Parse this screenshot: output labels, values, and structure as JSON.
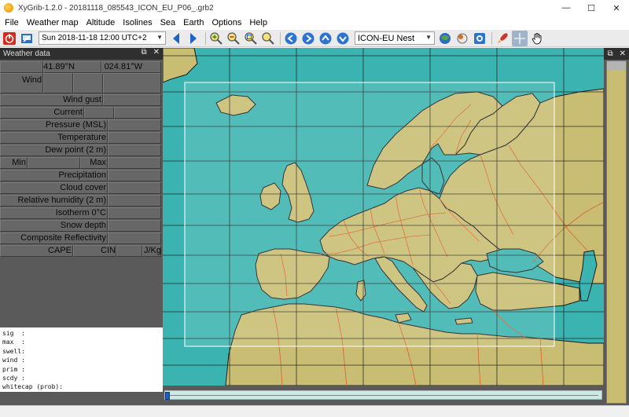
{
  "window": {
    "title": "XyGrib-1.2.0 - 20181118_085543_ICON_EU_P06_.grb2",
    "minimize": "—",
    "maximize": "☐",
    "close": "✕"
  },
  "menu": [
    "File",
    "Weather map",
    "Altitude",
    "Isolines",
    "Sea",
    "Earth",
    "Options",
    "Help"
  ],
  "toolbar": {
    "date_value": "Sun 2018-11-18 12:00 UTC+2",
    "model_value": "ICON-EU Nest"
  },
  "weather_panel": {
    "title": "Weather data",
    "latitude": "41.89°N",
    "longitude": "024.81°W",
    "labels": {
      "wind": "Wind",
      "wind_gust": "Wind gust",
      "current": "Current",
      "pressure": "Pressure (MSL)",
      "temperature": "Temperature",
      "dew_point": "Dew point (2 m)",
      "min": "Min",
      "max": "Max",
      "precipitation": "Precipitation",
      "cloud_cover": "Cloud cover",
      "relative_humidity": "Relative humidity (2 m)",
      "isotherm": "Isotherm 0°C",
      "snow_depth": "Snow depth",
      "composite_reflectivity": "Composite Reflectivity",
      "cape": "CAPE",
      "cin": "CIN",
      "jkg": "J/Kg"
    },
    "wave_text": "sig  :\nmax  :\nswell:\nwind :\nprim :\nscdy :\nwhitecap (prob):"
  },
  "colors": {
    "sea": "#3bb3b0",
    "land": "#c8bd72",
    "border": "#d9612a",
    "panel": "#5a5a5a"
  },
  "timeline": {
    "position": 0
  }
}
